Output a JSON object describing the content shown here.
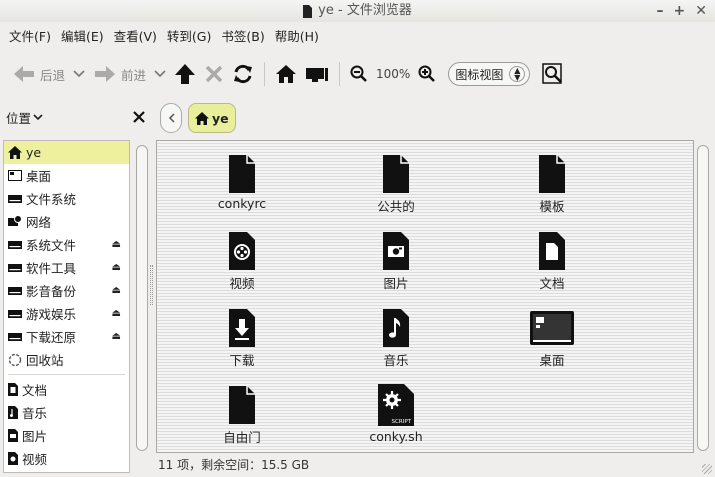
{
  "window": {
    "title": "ye - 文件浏览器",
    "controls": [
      "–",
      "+",
      "✕"
    ]
  },
  "menu": [
    "文件(F)",
    "编辑(E)",
    "查看(V)",
    "转到(G)",
    "书签(B)",
    "帮助(H)"
  ],
  "toolbar": {
    "back_label": "后退",
    "forward_label": "前进",
    "zoom_level": "100%",
    "view_mode": "图标视图"
  },
  "sidebar": {
    "header": "位置",
    "items": [
      {
        "label": "ye",
        "icon": "home-icon"
      },
      {
        "label": "桌面",
        "icon": "desktop-icon"
      },
      {
        "label": "文件系统",
        "icon": "drive-icon"
      },
      {
        "label": "网络",
        "icon": "network-icon"
      },
      {
        "label": "系统文件",
        "icon": "drive-icon",
        "eject": true
      },
      {
        "label": "软件工具",
        "icon": "drive-icon",
        "eject": true
      },
      {
        "label": "影音备份",
        "icon": "drive-icon",
        "eject": true
      },
      {
        "label": "游戏娱乐",
        "icon": "drive-icon",
        "eject": true
      },
      {
        "label": "下载还原",
        "icon": "drive-icon",
        "eject": true
      },
      {
        "label": "回收站",
        "icon": "trash-icon"
      }
    ],
    "bookmarks": [
      {
        "label": "文档",
        "icon": "document-folder-icon"
      },
      {
        "label": "音乐",
        "icon": "music-folder-icon"
      },
      {
        "label": "图片",
        "icon": "pictures-folder-icon"
      },
      {
        "label": "视频",
        "icon": "video-folder-icon"
      }
    ]
  },
  "pathbar": {
    "crumb": "ye"
  },
  "files": [
    {
      "name": "conkyrc",
      "icon": "folder-icon"
    },
    {
      "name": "公共的",
      "icon": "folder-icon"
    },
    {
      "name": "模板",
      "icon": "folder-icon"
    },
    {
      "name": "视频",
      "icon": "video-folder-icon"
    },
    {
      "name": "图片",
      "icon": "pictures-folder-icon"
    },
    {
      "name": "文档",
      "icon": "document-folder-icon"
    },
    {
      "name": "下载",
      "icon": "download-folder-icon"
    },
    {
      "name": "音乐",
      "icon": "music-folder-icon"
    },
    {
      "name": "桌面",
      "icon": "desktop-folder-icon"
    },
    {
      "name": "自由门",
      "icon": "folder-icon"
    },
    {
      "name": "conky.sh",
      "icon": "script-file-icon",
      "badge": "SCRIPT"
    }
  ],
  "status": "11 项，剩余空间：15.5 GB",
  "colors": {
    "selection": "#eef09e",
    "icon": "#111111"
  }
}
